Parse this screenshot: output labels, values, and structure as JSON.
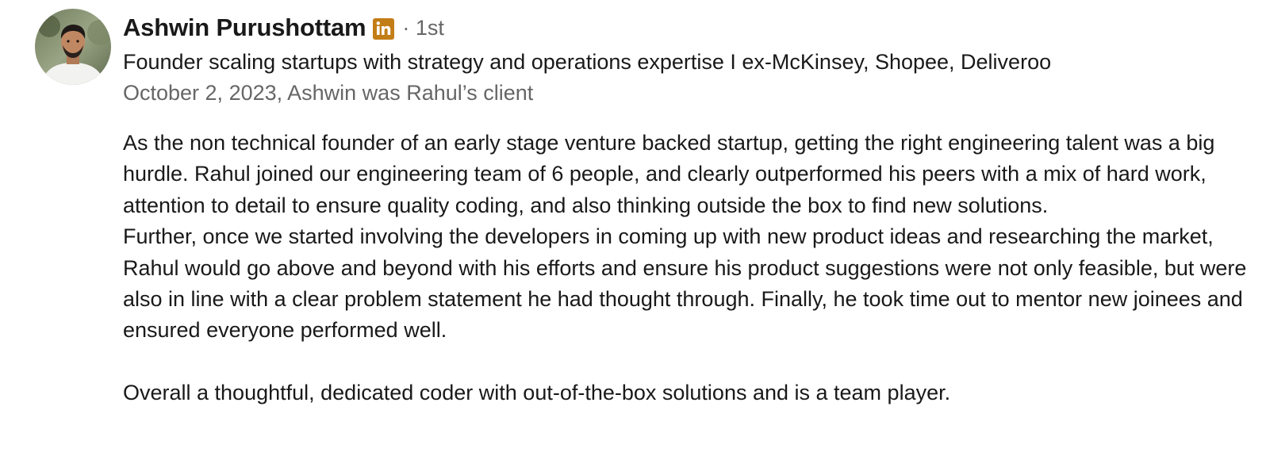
{
  "recommendation": {
    "author_name": "Ashwin Purushottam",
    "connection_degree": "· 1st",
    "headline": "Founder scaling startups with strategy and operations expertise I ex-McKinsey, Shopee, Deliveroo",
    "meta": "October 2, 2023, Ashwin was Rahul’s client",
    "badge_icon": "linkedin-in-icon",
    "badge_color": "#c37d16",
    "paragraphs": [
      "As the non technical founder of an early stage venture backed startup, getting the right engineering talent was a big hurdle. Rahul joined our engineering team of 6 people, and clearly outperformed his peers with a mix of hard work, attention to detail to ensure quality coding, and also thinking outside the box to find new solutions.",
      "Further, once we started involving the developers in coming up with new product ideas and researching the market, Rahul would go above and beyond with his efforts and ensure his product suggestions were not only feasible, but were also in line with a clear problem statement he had thought through. Finally, he took time out to mentor new joinees and ensured everyone performed well.",
      "Overall a thoughtful, dedicated coder with out-of-the-box solutions and is a team player."
    ]
  }
}
